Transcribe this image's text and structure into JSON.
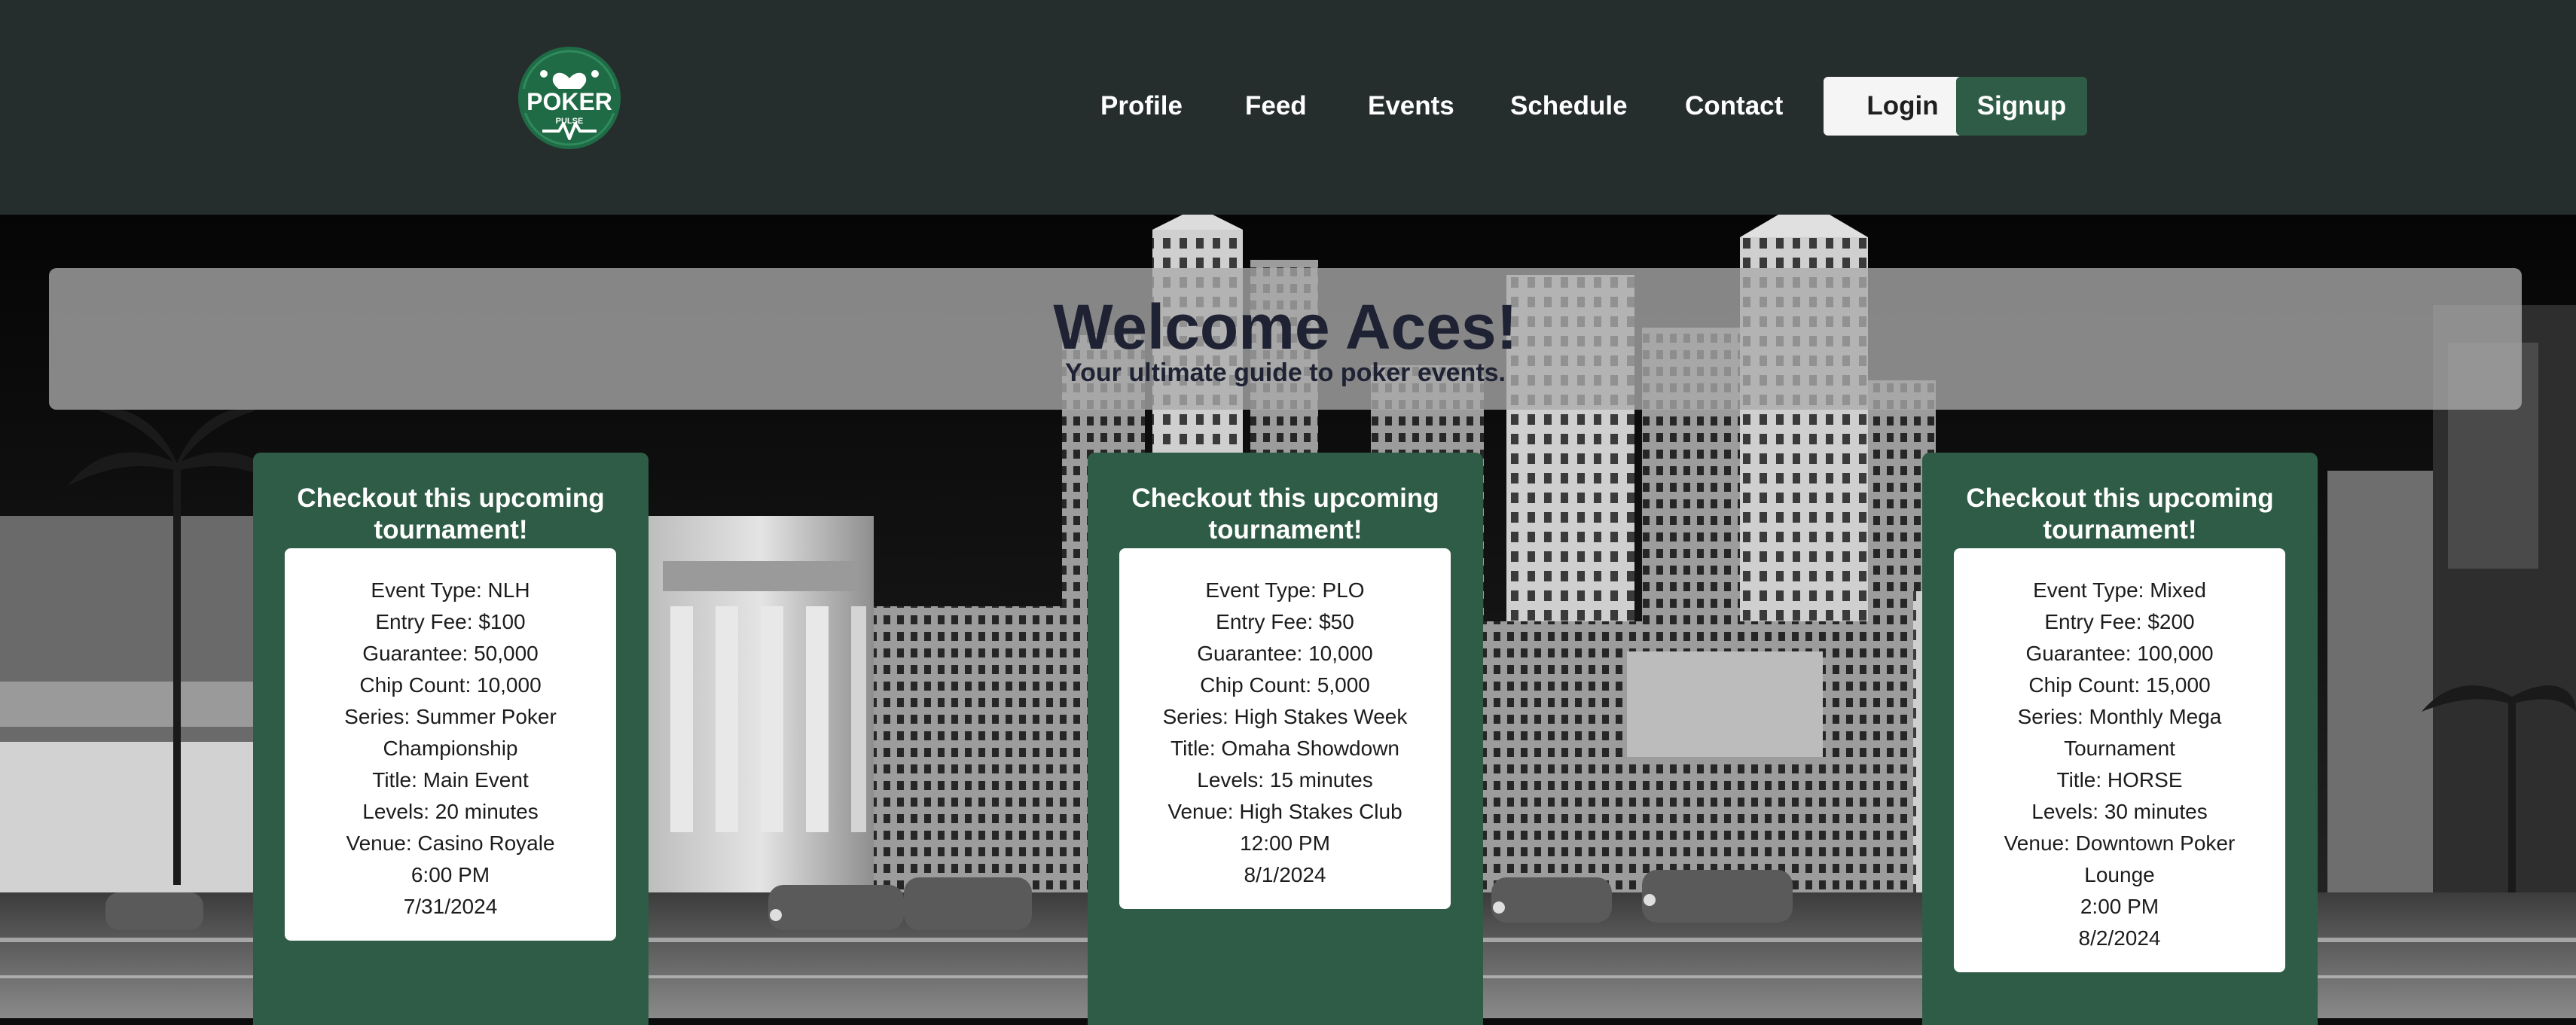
{
  "brand": {
    "logo_text": "POKER",
    "logo_subtext": "PULSE",
    "colors": {
      "header": "#262d2d",
      "accent": "#2f5c47",
      "logo_green": "#1f6b45"
    }
  },
  "nav": {
    "items": [
      {
        "label": "Profile"
      },
      {
        "label": "Feed"
      },
      {
        "label": "Events"
      },
      {
        "label": "Schedule"
      },
      {
        "label": "Contact"
      }
    ],
    "login_label": "Login",
    "signup_label": "Signup"
  },
  "banner": {
    "title": "Welcome Aces!",
    "subtitle": "Your ultimate guide to poker events."
  },
  "tournaments": [
    {
      "heading": "Checkout this upcoming tournament!",
      "event_type": "Event Type: NLH",
      "entry_fee": "Entry Fee: $100",
      "guarantee": "Guarantee: 50,000",
      "chip_count": "Chip Count: 10,000",
      "series": "Series: Summer Poker Championship",
      "title": "Title: Main Event",
      "levels": "Levels: 20 minutes",
      "venue": "Venue: Casino Royale",
      "time": "6:00 PM",
      "date": "7/31/2024"
    },
    {
      "heading": "Checkout this upcoming tournament!",
      "event_type": "Event Type: PLO",
      "entry_fee": "Entry Fee: $50",
      "guarantee": "Guarantee: 10,000",
      "chip_count": "Chip Count: 5,000",
      "series": "Series: High Stakes Week",
      "title": "Title: Omaha Showdown",
      "levels": "Levels: 15 minutes",
      "venue": "Venue: High Stakes Club",
      "time": "12:00 PM",
      "date": "8/1/2024"
    },
    {
      "heading": "Checkout this upcoming tournament!",
      "event_type": "Event Type: Mixed",
      "entry_fee": "Entry Fee: $200",
      "guarantee": "Guarantee: 100,000",
      "chip_count": "Chip Count: 15,000",
      "series": "Series: Monthly Mega Tournament",
      "title": "Title: HORSE",
      "levels": "Levels: 30 minutes",
      "venue": "Venue: Downtown Poker Lounge",
      "time": "2:00 PM",
      "date": "8/2/2024"
    }
  ],
  "icons": {
    "logo": "poker-pulse-logo-icon",
    "hero": "city-skyline-background"
  }
}
